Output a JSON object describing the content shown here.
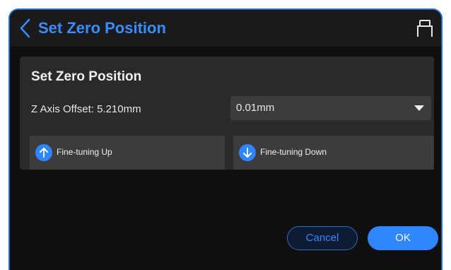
{
  "header": {
    "title": "Set Zero Position",
    "back_icon": "chevron-left-icon",
    "right_icon": "printer-icon"
  },
  "panel": {
    "title": "Set Zero Position",
    "offset_label": "Z Axis Offset: 5.210mm",
    "step_select": {
      "value": "0.01mm"
    },
    "fine_up": {
      "label": "Fine-tuning Up",
      "icon": "arrow-up-icon"
    },
    "fine_down": {
      "label": "Fine-tuning Down",
      "icon": "arrow-down-icon"
    }
  },
  "footer": {
    "cancel_label": "Cancel",
    "ok_label": "OK"
  },
  "colors": {
    "accent": "#2f86ff",
    "title": "#3a8cff",
    "background": "#0f0f0f",
    "panel": "#2a2a2a",
    "control": "#3c3c3c"
  }
}
